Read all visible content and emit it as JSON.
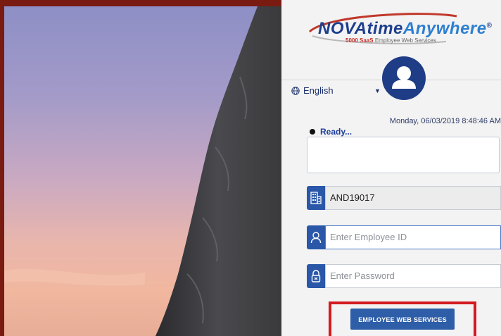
{
  "logo": {
    "brand_main": "NOVAtime",
    "brand_accent": "Anywhere",
    "registered": "®",
    "tagline_bold": "5000 SaaS",
    "tagline": "Employee Web Services"
  },
  "language": {
    "selected": "English",
    "icon": "globe-icon",
    "caret": "▼"
  },
  "datetime": "Monday, 06/03/2019 8:48:46 AM",
  "status": {
    "text": "Ready..."
  },
  "message_box": {
    "value": ""
  },
  "company_field": {
    "value": "AND19017",
    "icon": "building-icon"
  },
  "employee_field": {
    "placeholder": "Enter Employee ID",
    "icon": "user-icon"
  },
  "password_field": {
    "placeholder": "Enter Password",
    "icon": "lock-icon"
  },
  "submit": {
    "label": "EMPLOYEE WEB SERVICES"
  },
  "colors": {
    "primary": "#2e5ea8",
    "brand_dark": "#1d3f8e",
    "highlight": "#d31a20",
    "frame": "#7a1b12"
  }
}
